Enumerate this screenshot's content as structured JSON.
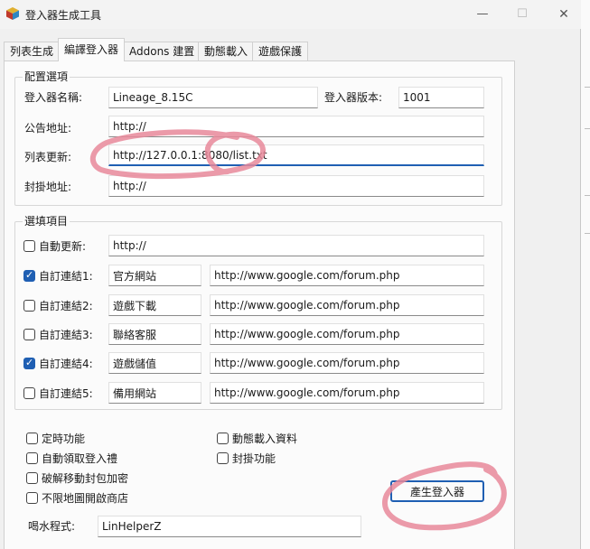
{
  "window": {
    "title": "登入器生成工具",
    "min_glyph": "—",
    "max_glyph": "☐",
    "close_glyph": "✕",
    "icon": "app-cube-icon"
  },
  "tabs": [
    {
      "label": "列表生成",
      "active": false
    },
    {
      "label": "編譯登入器",
      "active": true
    },
    {
      "label": "Addons 建置",
      "active": false
    },
    {
      "label": "動態載入",
      "active": false
    },
    {
      "label": "遊戲保護",
      "active": false
    }
  ],
  "config_group": {
    "title": "配置選項",
    "launcher_name_label": "登入器名稱:",
    "launcher_name_value": "Lineage_8.15C",
    "launcher_version_label": "登入器版本:",
    "launcher_version_value": "1001",
    "notice_url_label": "公告地址:",
    "notice_url_value": "http://",
    "list_update_label": "列表更新:",
    "list_update_value": "http://127.0.0.1:8080/list.txt",
    "plugin_url_label": "封掛地址:",
    "plugin_url_value": "http://"
  },
  "options_group": {
    "title": "選填項目",
    "auto_update": {
      "label": "自動更新:",
      "checked": false,
      "value": "http://"
    },
    "links": [
      {
        "label": "自訂連結1:",
        "checked": true,
        "name": "官方網站",
        "url": "http://www.google.com/forum.php"
      },
      {
        "label": "自訂連結2:",
        "checked": false,
        "name": "遊戲下載",
        "url": "http://www.google.com/forum.php"
      },
      {
        "label": "自訂連結3:",
        "checked": false,
        "name": "聯絡客服",
        "url": "http://www.google.com/forum.php"
      },
      {
        "label": "自訂連結4:",
        "checked": true,
        "name": "遊戲儲值",
        "url": "http://www.google.com/forum.php"
      },
      {
        "label": "自訂連結5:",
        "checked": false,
        "name": "備用網站",
        "url": "http://www.google.com/forum.php"
      }
    ]
  },
  "features": [
    {
      "label": "定時功能",
      "checked": false
    },
    {
      "label": "自動領取登入禮",
      "checked": false
    },
    {
      "label": "破解移動封包加密",
      "checked": false
    },
    {
      "label": "不限地圖開啟商店",
      "checked": false
    },
    {
      "label": "動態載入資料",
      "checked": false
    },
    {
      "label": "封掛功能",
      "checked": false
    }
  ],
  "water_program": {
    "label": "喝水程式:",
    "value": "LinHelperZ"
  },
  "generate_button": "產生登入器",
  "colors": {
    "accent": "#1f5fb3",
    "annotation": "#e8889a"
  }
}
